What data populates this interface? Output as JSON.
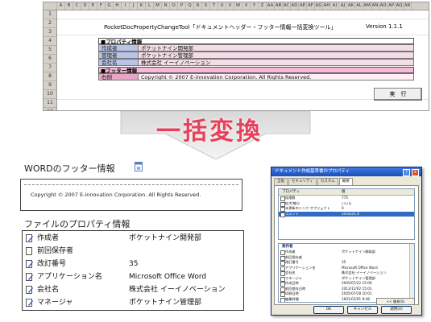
{
  "sheet": {
    "columns": [
      "A",
      "B",
      "C",
      "D",
      "E",
      "F",
      "G",
      "H",
      "I",
      "J",
      "K",
      "L",
      "M",
      "N",
      "O",
      "P",
      "Q",
      "R",
      "S",
      "T",
      "U",
      "V",
      "W",
      "X",
      "Y",
      "Z",
      "AA",
      "AB",
      "AC",
      "AD",
      "AE",
      "AF",
      "AG",
      "AH",
      "AI",
      "AJ",
      "AK",
      "AL",
      "AM",
      "AN",
      "AO",
      "AP",
      "AQ",
      "AR"
    ],
    "rows": [
      "1",
      "2",
      "3",
      "4",
      "5",
      "6",
      "7",
      "8",
      "9",
      "10",
      "11",
      "12"
    ],
    "title": "PocketDocPropertyChangeTool「ドキュメントヘッダー・フッター情報一括変換ツール」",
    "version": "Version 1.1.1",
    "property_section": "■プロパティ情報",
    "properties": [
      {
        "label": "作成者",
        "value": "ポケットナイン開発部"
      },
      {
        "label": "管理者",
        "value": "ポケットナイン管理部"
      },
      {
        "label": "会社名",
        "value": "株式会社 イーイノベーション"
      }
    ],
    "footer_section": "■フッター情報",
    "footer_label": "右側",
    "footer_value": "Copyright © 2007 E-innovation Corporation. All Rights Reserved.",
    "execute_label": "実　行"
  },
  "banner": "一括変換",
  "word": {
    "title": "WORDのフッター情報",
    "footer_text": "Copyright © 2007 E-innovation Corporation. All Rights Reserved."
  },
  "file_props": {
    "title": "ファイルのプロパティ情報",
    "rows": [
      {
        "name": "作成者",
        "value": "ポケットナイン開発部"
      },
      {
        "name": "前回保存者",
        "value": ""
      },
      {
        "name": "改訂番号",
        "value": "35"
      },
      {
        "name": "アプリケーション名",
        "value": "Microsoft Office Word"
      },
      {
        "name": "会社名",
        "value": "株式会社 イーイノベーション"
      },
      {
        "name": "マネージャ",
        "value": "ポケットナイン管理部"
      }
    ]
  },
  "dialog": {
    "title": "ドキュメント作成基準書のプロパティ",
    "help_label": "?",
    "close_label": "×",
    "tabs": [
      "全般",
      "セキュリティ",
      "カスタム",
      "概要"
    ],
    "active_tab": "概要",
    "col_property": "プロパティ",
    "col_value": "値",
    "list1": [
      {
        "name": "段落数",
        "value": "775"
      },
      {
        "name": "拡大/縮小",
        "value": "いいえ"
      },
      {
        "name": "未更新のリンク オブジェクト",
        "value": "0"
      },
      {
        "name": "コメント",
        "value": "version1.0"
      }
    ],
    "origin_section": "発作者",
    "list2": [
      {
        "name": "作成者",
        "value": "ポケットナイン開発部"
      },
      {
        "name": "前回保存者",
        "value": ""
      },
      {
        "name": "改訂番号",
        "value": "35"
      },
      {
        "name": "アプリケーション名",
        "value": "Microsoft Office Word"
      },
      {
        "name": "会社名",
        "value": "株式会社 イーイノベーション"
      },
      {
        "name": "マネージャ",
        "value": "ポケットナイン管理部"
      },
      {
        "name": "作成日時",
        "value": "2005/07/22 15:09"
      },
      {
        "name": "前回保存日時",
        "value": "2013/12/02 15:01"
      },
      {
        "name": "印刷日時",
        "value": "2005/07/28 10:01"
      },
      {
        "name": "編集時間",
        "value": "1601/01/01 9:48"
      }
    ],
    "advanced_label": "<< 簡易(S)",
    "ok_label": "OK",
    "cancel_label": "キャンセル",
    "apply_label": "適用(A)"
  },
  "colors": {
    "banner": "#e8405a",
    "section_pink": "#f8b8d8",
    "label_blue": "#b8c4e8",
    "titlebar": "#1c4fb8"
  }
}
